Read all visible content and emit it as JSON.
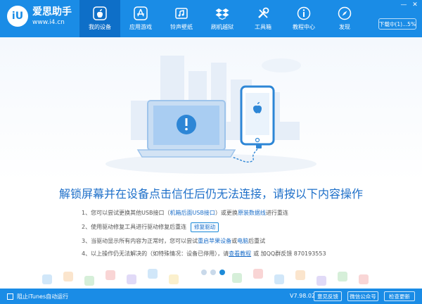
{
  "app": {
    "logo_badge": "iU",
    "name": "爱思助手",
    "url": "www.i4.cn"
  },
  "nav": [
    {
      "label": "我的设备",
      "icon": "apple-icon"
    },
    {
      "label": "应用游戏",
      "icon": "app-store-icon"
    },
    {
      "label": "铃声壁纸",
      "icon": "ringtone-wallpaper-icon"
    },
    {
      "label": "刷机越狱",
      "icon": "dropbox-flash-icon"
    },
    {
      "label": "工具箱",
      "icon": "tools-icon"
    },
    {
      "label": "教程中心",
      "icon": "info-icon"
    },
    {
      "label": "发现",
      "icon": "compass-icon"
    }
  ],
  "window": {
    "minimize": "—",
    "close": "✕",
    "download_btn": "下载中(1)...5%"
  },
  "main": {
    "headline": "解锁屏幕并在设备点击信任后仍无法连接，请按以下内容操作",
    "step1_a": "1、您可以尝试更换其他USB接口（",
    "step1_b": "机箱后面USB接口",
    "step1_c": "）或更换",
    "step1_d": "原装数据线",
    "step1_e": "进行重连",
    "step2": "2、使用驱动修复工具进行驱动修复后重连",
    "fix_driver_btn": "修复驱动",
    "step3_a": "3、当驱动显示所有内容为正常时，您可以尝试",
    "step3_b": "重启苹果设备",
    "step3_c": "或",
    "step3_d": "电脑",
    "step3_e": "后重试",
    "step4_a": "4、以上操作仍无法解决的（如特殊情况：设备已停用），请",
    "step4_link": "查看教程",
    "step4_b": "或 加QQ群反馈 870193553"
  },
  "status": {
    "itunes_auto_run": "阻止iTunes自动运行",
    "version": "V7.98.02",
    "feedback": "意见反馈",
    "wechat": "微信公众号",
    "check_update": "检查更新"
  },
  "colors": {
    "brand": "#1a8ce6",
    "accent_text": "#1d6fc9"
  }
}
